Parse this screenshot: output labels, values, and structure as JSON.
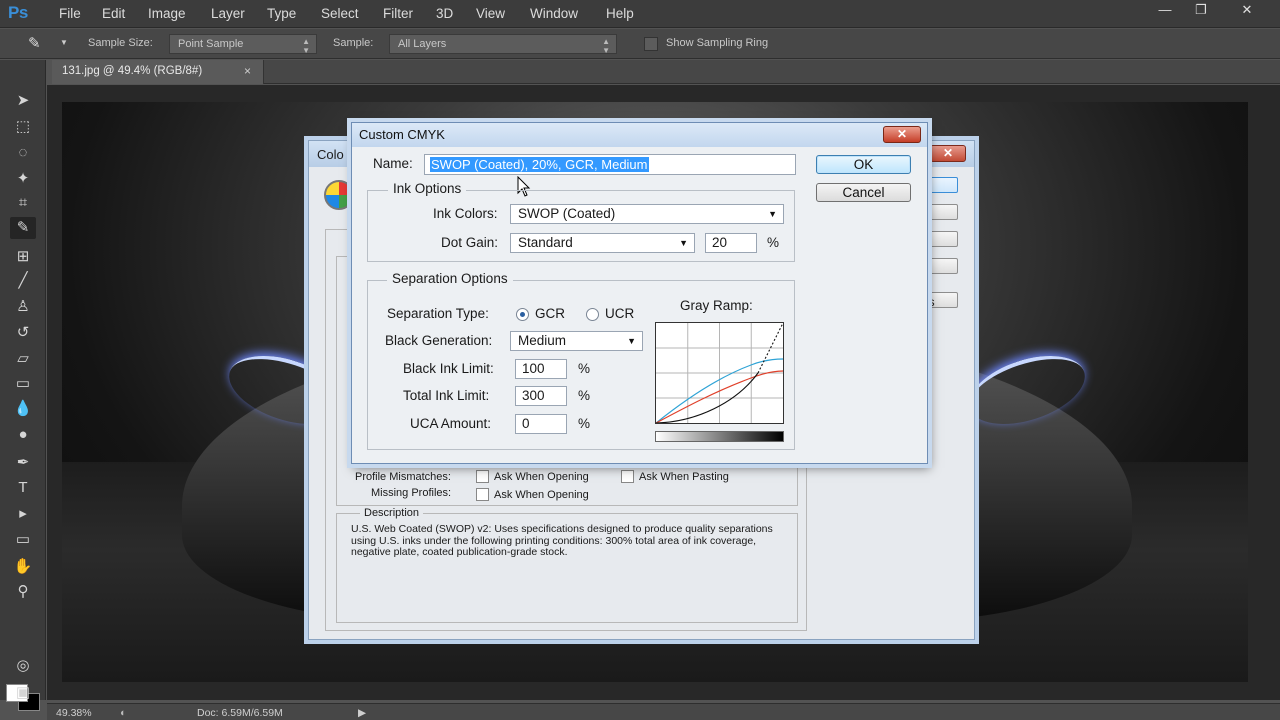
{
  "app": {
    "logo": "Ps",
    "menu": [
      "File",
      "Edit",
      "Image",
      "Layer",
      "Type",
      "Select",
      "Filter",
      "3D",
      "View",
      "Window",
      "Help"
    ],
    "window_controls": {
      "minimize": "—",
      "restore": "❐",
      "close": "✕"
    }
  },
  "options_bar": {
    "sample_size_label": "Sample Size:",
    "sample_size_value": "Point Sample",
    "sample_label": "Sample:",
    "sample_value": "All Layers",
    "show_ring_label": "Show Sampling Ring"
  },
  "document_tab": {
    "title": "131.jpg @ 49.4% (RGB/8#)",
    "close": "×"
  },
  "status_bar": {
    "zoom": "49.38%",
    "doc": "Doc: 6.59M/6.59M"
  },
  "color_settings_dialog": {
    "title_partial": "Colo",
    "button_text_partial": "ns",
    "profile_mismatches_label": "Profile Mismatches:",
    "missing_profiles_label": "Missing Profiles:",
    "ask_when_opening": "Ask When Opening",
    "ask_when_pasting": "Ask When Pasting",
    "ask_when_opening_2": "Ask When Opening",
    "description_title": "Description",
    "description_text": "U.S. Web Coated (SWOP) v2:  Uses specifications designed to produce quality separations using U.S. inks under the following printing conditions: 300% total area of ink coverage, negative plate, coated publication-grade stock."
  },
  "custom_cmyk": {
    "title": "Custom CMYK",
    "name_label": "Name:",
    "name_value": "SWOP (Coated), 20%, GCR, Medium",
    "ok": "OK",
    "cancel": "Cancel",
    "ink_options": {
      "legend": "Ink Options",
      "ink_colors_label": "Ink Colors:",
      "ink_colors_value": "SWOP (Coated)",
      "dot_gain_label": "Dot Gain:",
      "dot_gain_value": "Standard",
      "dot_gain_amount": "20",
      "dot_gain_unit": "%"
    },
    "separation_options": {
      "legend": "Separation Options",
      "separation_type_label": "Separation Type:",
      "gcr": "GCR",
      "ucr": "UCR",
      "selected": "GCR",
      "black_generation_label": "Black Generation:",
      "black_generation_value": "Medium",
      "black_ink_limit_label": "Black Ink Limit:",
      "black_ink_limit_value": "100",
      "total_ink_limit_label": "Total Ink Limit:",
      "total_ink_limit_value": "300",
      "uca_amount_label": "UCA Amount:",
      "uca_amount_value": "0",
      "percent": "%",
      "gray_ramp_label": "Gray Ramp:"
    }
  },
  "colors": {
    "selection": "#3399ff",
    "ramp_cyan": "#2ea3d6",
    "ramp_red": "#e0402a",
    "ramp_black": "#111111"
  }
}
